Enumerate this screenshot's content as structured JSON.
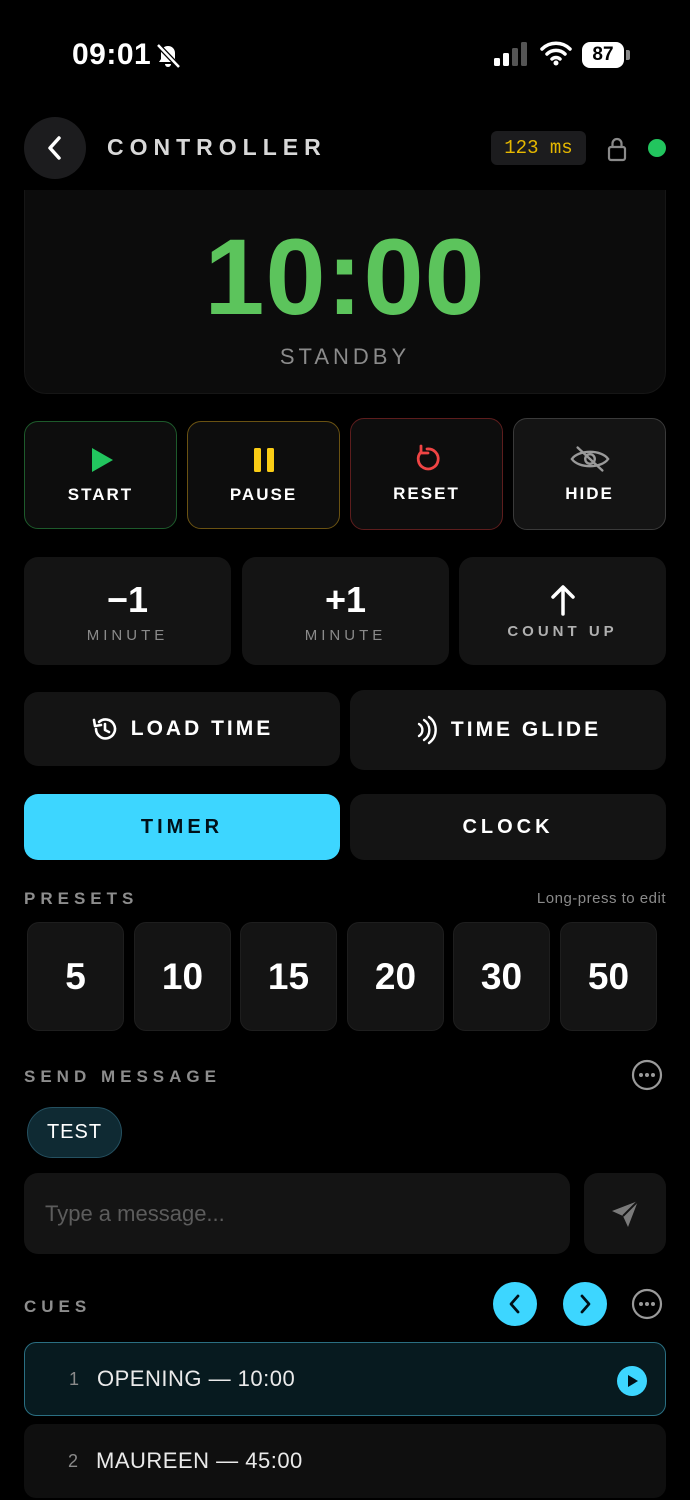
{
  "status_bar": {
    "time": "09:01",
    "battery": "87"
  },
  "header": {
    "title": "CONTROLLER",
    "latency": "123 ms"
  },
  "display": {
    "time": "10:00",
    "state": "STANDBY"
  },
  "transport": {
    "start_label": "START",
    "pause_label": "PAUSE",
    "reset_label": "RESET",
    "hide_label": "HIDE"
  },
  "adjust": {
    "minus": {
      "value": "−1",
      "unit": "MINUTE"
    },
    "plus": {
      "value": "+1",
      "unit": "MINUTE"
    },
    "count_up": "COUNT UP"
  },
  "actions": {
    "load_time": "LOAD TIME",
    "time_glide": "TIME GLIDE"
  },
  "mode": {
    "timer": "TIMER",
    "clock": "CLOCK",
    "selected": "TIMER"
  },
  "presets": {
    "label": "PRESETS",
    "hint": "Long-press to edit",
    "items": [
      "5",
      "10",
      "15",
      "20",
      "30",
      "50"
    ]
  },
  "message": {
    "label": "SEND MESSAGE",
    "chips": [
      "TEST"
    ],
    "placeholder": "Type a message..."
  },
  "cues": {
    "label": "CUES",
    "items": [
      {
        "num": "1",
        "name": "OPENING — 10:00",
        "active": true
      },
      {
        "num": "2",
        "name": "MAUREEN — 45:00",
        "active": false
      }
    ]
  },
  "colors": {
    "accent": "#3dd6ff",
    "timer_green": "#5cc45c",
    "start_green": "#22c55e",
    "pause_yellow": "#facc15",
    "reset_red": "#ef4444",
    "latency_yellow": "#e6b800"
  }
}
